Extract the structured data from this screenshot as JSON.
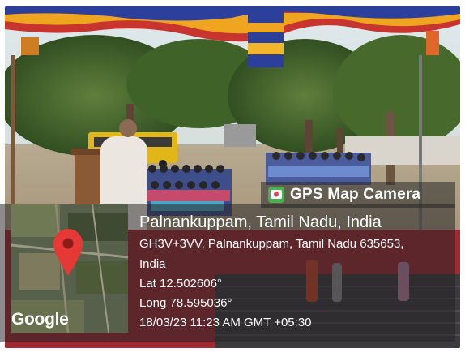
{
  "badge": {
    "title": "GPS Map Camera",
    "icon": "gps-map-camera-icon"
  },
  "map": {
    "brand": "Google",
    "icon": "map-pin-icon",
    "pin_color": "#e53935"
  },
  "location": {
    "city": "Palnankuppam, Tamil Nadu, India",
    "address_line1": "GH3V+3VV, Palnankuppam, Tamil Nadu 635653,",
    "address_line2": "India",
    "lat": "Lat 12.502606°",
    "long": "Long 78.595036°",
    "datetime": "18/03/23 11:23 AM GMT +05:30"
  }
}
